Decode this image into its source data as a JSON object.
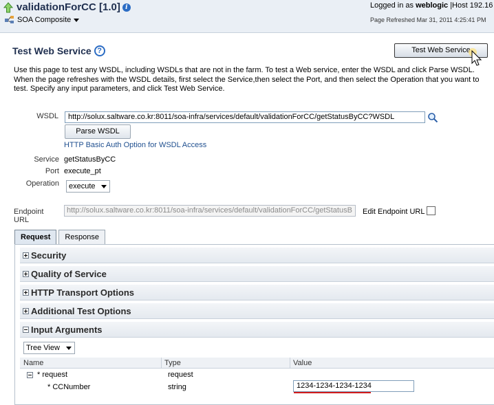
{
  "header": {
    "title": "validationForCC [1.0]",
    "composite_label": "SOA Composite",
    "logged_in_prefix": "Logged in as",
    "user": "weblogic",
    "host": "Host 192.16",
    "page_refreshed": "Page Refreshed Mar 31, 2011 4:25:41 PM"
  },
  "page": {
    "title": "Test Web Service",
    "test_button": "Test Web Service",
    "intro": "Use this page to test any WSDL, including WSDLs that are not in the farm. To test a Web service, enter the WSDL and click Parse WSDL. When the page refreshes with the WSDL details, first select the Service,then select the Port, and then select the Operation that you want to test. Specify any input parameters, and click Test Web Service."
  },
  "form": {
    "wsdl_label": "WSDL",
    "wsdl_value": "http://solux.saltware.co.kr:8011/soa-infra/services/default/validationForCC/getStatusByCC?WSDL",
    "parse_button": "Parse WSDL",
    "auth_link": "HTTP Basic Auth Option for WSDL Access",
    "service_label": "Service",
    "service_value": "getStatusByCC",
    "port_label": "Port",
    "port_value": "execute_pt",
    "operation_label": "Operation",
    "operation_value": "execute",
    "endpoint_label": "Endpoint URL",
    "endpoint_value": "http://solux.saltware.co.kr:8011/soa-infra/services/default/validationForCC/getStatusB",
    "edit_endpoint_label": "Edit Endpoint URL"
  },
  "tabs": [
    {
      "label": "Request",
      "active": true
    },
    {
      "label": "Response",
      "active": false
    }
  ],
  "sections": [
    {
      "title": "Security",
      "expanded": false
    },
    {
      "title": "Quality of Service",
      "expanded": false
    },
    {
      "title": "HTTP Transport Options",
      "expanded": false
    },
    {
      "title": "Additional Test Options",
      "expanded": false
    },
    {
      "title": "Input Arguments",
      "expanded": true
    }
  ],
  "input_args": {
    "view_select": "Tree View",
    "columns": [
      "Name",
      "Type",
      "Value"
    ],
    "rows": [
      {
        "name": "* request",
        "type": "request",
        "value": ""
      },
      {
        "name": "* CCNumber",
        "type": "string",
        "value": "1234-1234-1234-1234"
      }
    ]
  },
  "colors": {
    "header_bg": "#eaeff5",
    "link": "#1f4f8f",
    "highlight_underline": "#d21b1b"
  }
}
